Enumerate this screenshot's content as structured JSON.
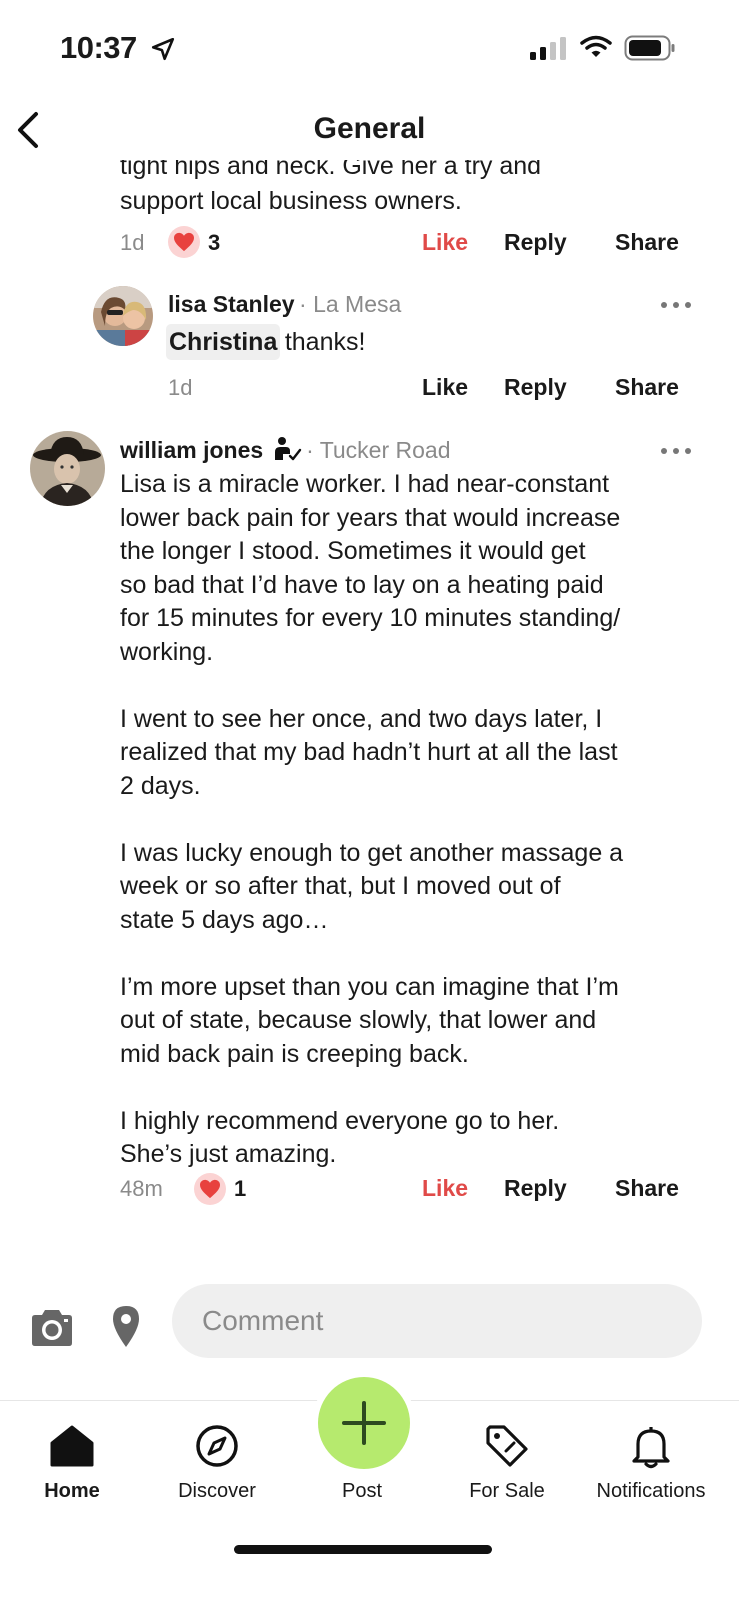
{
  "status_bar": {
    "time": "10:37"
  },
  "nav": {
    "title": "General"
  },
  "posts": [
    {
      "text_lines": [
        "tight hips and neck. Give her a try and",
        "support local business owners."
      ],
      "time": "1d",
      "reaction_count": "3",
      "like_label": "Like",
      "reply_label": "Reply",
      "share_label": "Share"
    },
    {
      "author": "lisa Stanley",
      "location": "· La Mesa",
      "mention": "Christina",
      "text": "thanks!",
      "time": "1d",
      "like_label": "Like",
      "reply_label": "Reply",
      "share_label": "Share"
    },
    {
      "author": "william jones",
      "location": "· Tucker Road",
      "paragraphs": [
        [
          "Lisa is a miracle worker.  I had near-constant",
          "lower back pain for years that would increase",
          "the longer I stood.  Sometimes it would get",
          "so bad that I’d have to lay on a heating paid",
          "for 15 minutes for every 10 minutes standing/",
          "working."
        ],
        [
          "I went to see her once, and two days later, I",
          "realized that my bad hadn’t hurt at all the last",
          "2 days."
        ],
        [
          "I was lucky enough to get another massage a",
          "week or so after that, but I moved out of",
          "state 5 days ago…"
        ],
        [
          "I’m more upset than you can imagine that I’m",
          "out of state, because slowly, that lower and",
          "mid back pain is creeping back."
        ],
        [
          "I highly recommend everyone go to her.",
          "She’s just amazing."
        ]
      ],
      "time": "48m",
      "reaction_count": "1",
      "like_label": "Like",
      "reply_label": "Reply",
      "share_label": "Share"
    }
  ],
  "composer": {
    "placeholder": "Comment"
  },
  "tabs": [
    {
      "label": "Home",
      "icon": "home-icon"
    },
    {
      "label": "Discover",
      "icon": "compass-icon"
    },
    {
      "label": "Post",
      "icon": "plus-icon"
    },
    {
      "label": "For Sale",
      "icon": "tag-icon"
    },
    {
      "label": "Notifications",
      "icon": "bell-icon"
    }
  ],
  "colors": {
    "liked": "#e04a48",
    "post_button": "#b6ea6e",
    "comment_bg": "#efefef"
  }
}
